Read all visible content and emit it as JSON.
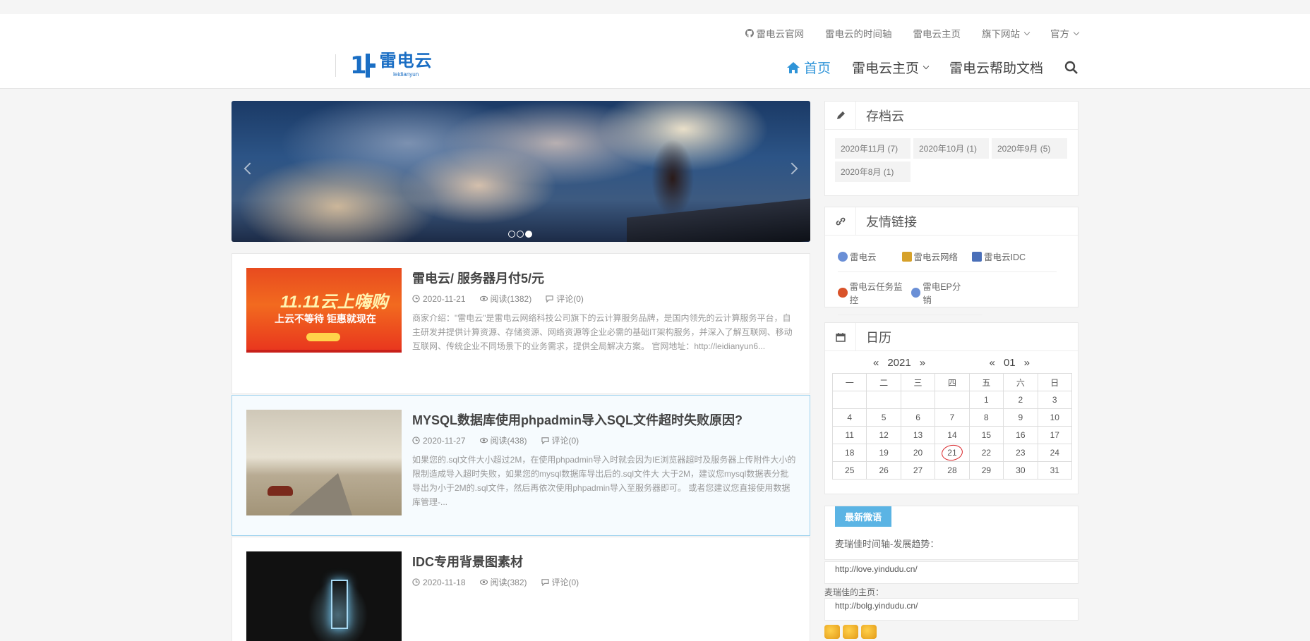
{
  "header": {
    "topnav": [
      "雷电云官网",
      "雷电云的时间轴",
      "雷电云主页",
      "旗下网站",
      "官方"
    ],
    "logo": {
      "cn": "雷电云",
      "en": "leidianyun",
      "mark": "1"
    },
    "mainnav": {
      "home": "首页",
      "main": "雷电云主页",
      "docs": "雷电云帮助文档"
    }
  },
  "posts": [
    {
      "title": "雷电云/ 服务器月付5/元",
      "date": "2020-11-21",
      "reads": "阅读(1382)",
      "comments": "评论(0)",
      "excerpt": "商家介绍：\"雷电云\"是雷电云网络科技公司旗下的云计算服务品牌，是国内领先的云计算服务平台，自主研发并提供计算资源、存储资源、网络资源等企业必需的基础IT架构服务，并深入了解互联网、移动互联网、传统企业不同场景下的业务需求，提供全局解决方案。 官网地址：http://leidianyun6...",
      "thumb_big": "11.11云上嗨购",
      "thumb_sub": "上云不等待 钜惠就现在"
    },
    {
      "title": "MYSQL数据库使用phpadmin导入SQL文件超时失败原因?",
      "date": "2020-11-27",
      "reads": "阅读(438)",
      "comments": "评论(0)",
      "excerpt": "如果您的.sql文件大小超过2M，在使用phpadmin导入时就会因为IE浏览器超时及服务器上传附件大小的限制造成导入超时失败，如果您的mysql数据库导出后的.sql文件大 大于2M，建议您mysql数据表分批导出为小于2M的.sql文件，然后再依次使用phpadmin导入至服务器即可。 或者您建议您直接使用数据库管理-..."
    },
    {
      "title": "IDC专用背景图素材",
      "date": "2020-11-18",
      "reads": "阅读(382)",
      "comments": "评论(0)"
    }
  ],
  "sidebar": {
    "archive": {
      "title": "存档云",
      "tags": [
        "2020年11月 (7)",
        "2020年10月 (1)",
        "2020年9月 (5)",
        "2020年8月 (1)"
      ]
    },
    "links": {
      "title": "友情链接",
      "items": [
        "雷电云",
        "雷电云网络",
        "雷电云IDC",
        "雷电云任务监控",
        "雷电EP分销"
      ]
    },
    "calendar": {
      "title": "日历",
      "year": "2021",
      "month": "01",
      "prev": "«",
      "next": "»",
      "weekdays": [
        "一",
        "二",
        "三",
        "四",
        "五",
        "六",
        "日"
      ],
      "today": "21"
    },
    "weibo": {
      "tab": "最新微语",
      "text": "麦瑞佳时间轴-发展趋势：",
      "link1": "http://love.yindudu.cn/",
      "label2": "麦瑞佳的主页：",
      "link2": "http://bolg.yindudu.cn/"
    }
  }
}
